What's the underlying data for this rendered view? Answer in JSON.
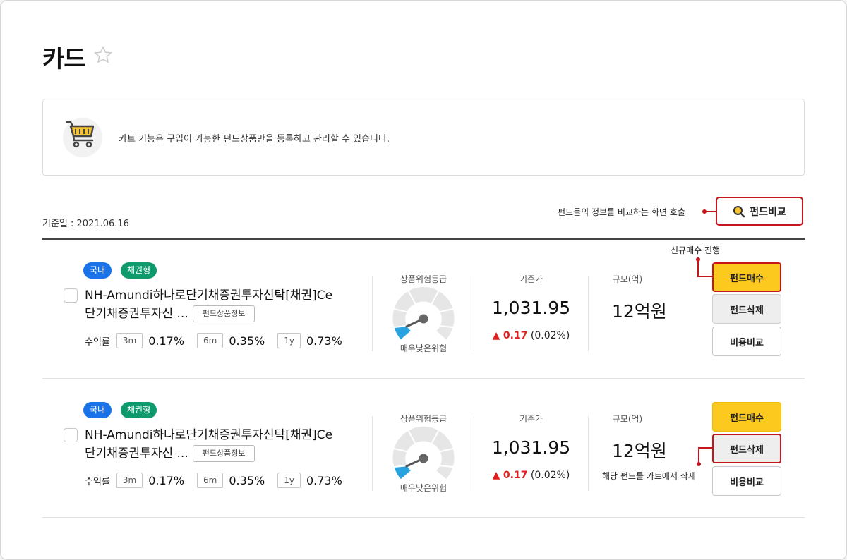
{
  "page": {
    "title": "카드"
  },
  "notice": {
    "text": "카트 기능은 구입이 가능한 펀드상품만을 등록하고 관리할 수 있습니다."
  },
  "base_date": "기준일 : 2021.06.16",
  "compare": {
    "label": "펀드비교",
    "note": "펀드들의 정보를 비교하는 화면 호출"
  },
  "annotations": {
    "buy": "신규매수 진행",
    "delete": "해당 펀드를 카트에서 삭제"
  },
  "colors": {
    "accent_red": "#c4161c",
    "buy_yellow": "#fcc91f",
    "badge_domestic": "#1a73e8",
    "badge_bond": "#0f9a6e",
    "risk_fill": "#29a3e0"
  },
  "labels": {
    "risk": "상품위험등급",
    "nav": "기준가",
    "size": "규모(억)",
    "returns": "수익률",
    "info_button": "펀드상품정보",
    "buy_button": "펀드매수",
    "delete_button": "펀드삭제",
    "cost_button": "비용비교"
  },
  "funds": [
    {
      "badges": [
        "국내",
        "채권형"
      ],
      "name_line1": "NH-Amundi하나로단기채증권투자신탁[채권]Ce",
      "name_line2": "단기채증권투자신 ...",
      "returns": [
        {
          "period": "3m",
          "value": "0.17%"
        },
        {
          "period": "6m",
          "value": "0.35%"
        },
        {
          "period": "1y",
          "value": "0.73%"
        }
      ],
      "risk_grade": "매우낮은위험",
      "risk_level": 1,
      "risk_levels_total": 6,
      "nav": "1,031.95",
      "nav_change": "0.17",
      "nav_change_pct": "(0.02%)",
      "size": "12억원"
    },
    {
      "badges": [
        "국내",
        "채권형"
      ],
      "name_line1": "NH-Amundi하나로단기채증권투자신탁[채권]Ce",
      "name_line2": "단기채증권투자신 ...",
      "returns": [
        {
          "period": "3m",
          "value": "0.17%"
        },
        {
          "period": "6m",
          "value": "0.35%"
        },
        {
          "period": "1y",
          "value": "0.73%"
        }
      ],
      "risk_grade": "매우낮은위험",
      "risk_level": 1,
      "risk_levels_total": 6,
      "nav": "1,031.95",
      "nav_change": "0.17",
      "nav_change_pct": "(0.02%)",
      "size": "12억원"
    }
  ]
}
